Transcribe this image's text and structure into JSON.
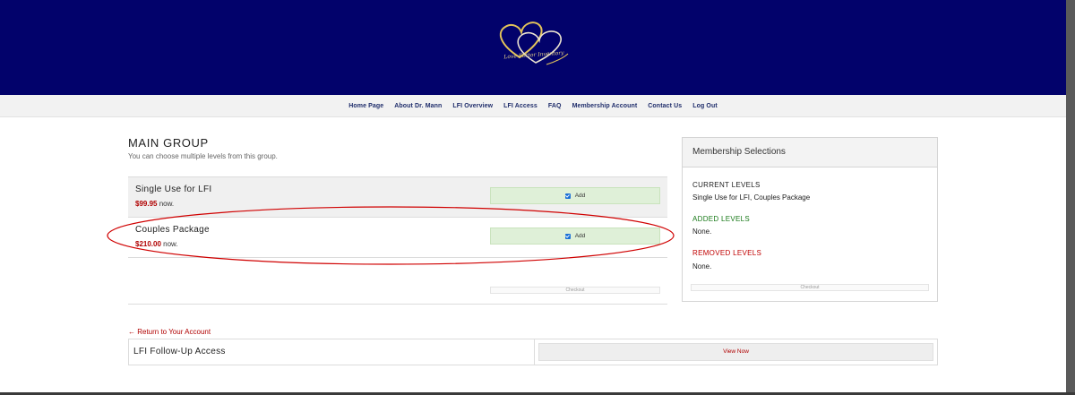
{
  "header": {
    "logo_text": "Love Factor Inventory"
  },
  "nav": {
    "items": [
      "Home Page",
      "About Dr. Mann",
      "LFI Overview",
      "LFI Access",
      "FAQ",
      "Membership Account",
      "Contact Us",
      "Log Out"
    ]
  },
  "group": {
    "title": "MAIN GROUP",
    "description": "You can choose multiple levels from this group.",
    "levels": [
      {
        "name": "Single Use for LFI",
        "price": "$99.95",
        "suffix": " now.",
        "button": "Add",
        "checked": true
      },
      {
        "name": "Couples Package",
        "price": "$210.00",
        "suffix": " now.",
        "button": "Add",
        "checked": true
      }
    ],
    "checkout_label": "Checkout"
  },
  "panel": {
    "title": "Membership Selections",
    "current_label": "CURRENT LEVELS",
    "current_value": "Single Use for LFI, Couples Package",
    "added_label": "ADDED LEVELS",
    "added_value": "None.",
    "removed_label": "REMOVED LEVELS",
    "removed_value": "None.",
    "checkout_label": "Checkout"
  },
  "footer": {
    "return_link": "← Return to Your Account",
    "followup_name": "LFI Follow-Up Access",
    "view_button": "View Now"
  },
  "colors": {
    "header_bg": "#02026b",
    "price": "#b00000",
    "added": "#1a7a1a",
    "removed": "#c00000",
    "add_button_bg": "#dff0d8",
    "annotation_ellipse": "#d00000"
  },
  "icons": {
    "logo": "double-heart-logo",
    "checkbox": "checkbox-checked-icon"
  }
}
